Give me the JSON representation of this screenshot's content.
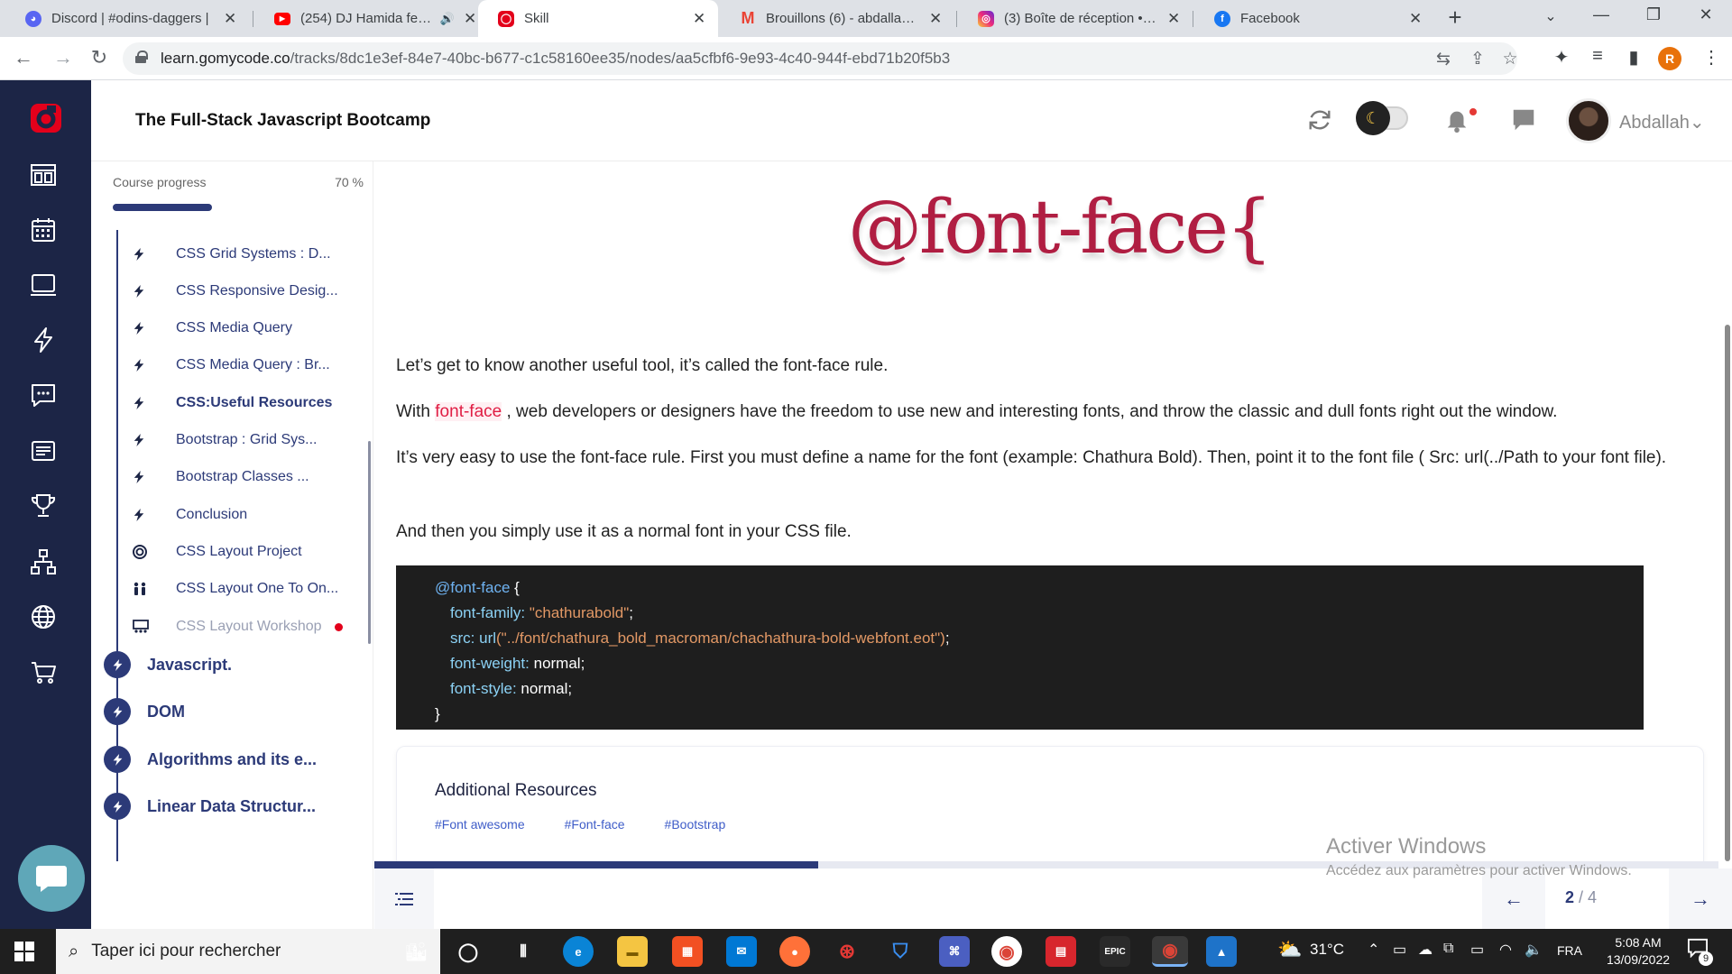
{
  "browser": {
    "tabs": [
      {
        "title": "Discord | #odins-daggers | ",
        "icon": "discord-icon",
        "color": "#5865f2"
      },
      {
        "title": "(254) DJ Hamida feat. A",
        "icon": "youtube-icon",
        "color": "#ff0000",
        "audio": "audio-playing-icon"
      },
      {
        "title": "Skill",
        "icon": "gomycode-icon",
        "color": "#e3001b",
        "active": true
      },
      {
        "title": "Brouillons (6) - abdallah.lah",
        "icon": "gmail-icon",
        "color": "#ea4335"
      },
      {
        "title": "(3) Boîte de réception • Dire",
        "icon": "instagram-icon",
        "color": "#d62976"
      },
      {
        "title": "Facebook",
        "icon": "facebook-icon",
        "color": "#1877f2"
      }
    ],
    "url_host": "learn.gomycode.co",
    "url_path": "/tracks/8dc1e3ef-84e7-40bc-b677-c1c58160ee35/nodes/aa5cfbf6-9e93-4c40-944f-ebd71b20f5b3",
    "profile_initial": "R"
  },
  "header": {
    "title": "The Full-Stack Javascript Bootcamp",
    "user_name": "Abdallah",
    "user_chevron": "⌄"
  },
  "sidebar": {
    "progress_label": "Course progress",
    "progress_text": "70 %",
    "progress_value": 0.7,
    "lessons": [
      {
        "label": "CSS Grid Systems : D...",
        "icon": "bolt-icon"
      },
      {
        "label": "CSS Responsive Desig...",
        "icon": "bolt-icon"
      },
      {
        "label": "CSS Media Query",
        "icon": "bolt-icon"
      },
      {
        "label": "CSS Media Query : Br...",
        "icon": "bolt-icon"
      },
      {
        "label": "CSS:Useful Resources",
        "icon": "bolt-icon",
        "active": true
      },
      {
        "label": "Bootstrap : Grid Sys...",
        "icon": "bolt-icon"
      },
      {
        "label": "Bootstrap Classes ...",
        "icon": "bolt-icon"
      },
      {
        "label": "Conclusion",
        "icon": "bolt-icon"
      },
      {
        "label": "CSS Layout Project",
        "icon": "target-icon"
      },
      {
        "label": "CSS Layout One To On...",
        "icon": "people-icon"
      },
      {
        "label": "CSS Layout Workshop",
        "icon": "workshop-icon",
        "dim": true,
        "dot": true
      }
    ],
    "modules": [
      {
        "label": "Javascript."
      },
      {
        "label": "DOM"
      },
      {
        "label": "Algorithms and its e..."
      },
      {
        "label": "Linear Data Structur..."
      }
    ]
  },
  "content": {
    "hero_text": "@font-face{",
    "p1": "Let’s get to know another useful tool, it’s called the font-face rule.",
    "p2_before": "With ",
    "p2_highlight": "font-face",
    "p2_after": " , web developers or designers have the freedom to use new and interesting fonts, and throw the classic and dull fonts right out the window.",
    "p3": "It’s very easy to use the font-face rule. First you must define a name for the font (example: Chathura Bold). Then, point it to the font file ( Src: url(../Path to your font file).",
    "p4": "And then you simply use it as a normal font in your CSS file.",
    "code": {
      "at_rule": "@font-face",
      "open": " {",
      "l1_prop": "font-family:",
      "l1_val": " \"chathurabold\"",
      "l1_end": ";",
      "l2_prop": "src:",
      "l2_fn": " url",
      "l2_val": "(\"../font/chathura_bold_macroman/chachathura-bold-webfont.eot\")",
      "l2_end": ";",
      "l3_prop": "font-weight:",
      "l3_val": " normal;",
      "l4_prop": "font-style:",
      "l4_val": " normal;",
      "close": "}"
    },
    "resources_title": "Additional Resources",
    "resource_tags": [
      "#Font awesome",
      "#Font-face",
      "#Bootstrap"
    ]
  },
  "pager": {
    "current": "2",
    "separator": " / ",
    "total": "4",
    "prev_glyph": "←",
    "next_glyph": "→",
    "lesson_progress": 0.33
  },
  "watermark": {
    "line1": "Activer Windows",
    "line2": "Accédez aux paramètres pour activer Windows."
  },
  "taskbar": {
    "search_placeholder": "Taper ici pour rechercher",
    "weather": "31°C",
    "language": "FRA",
    "time": "5:08 AM",
    "date": "13/09/2022",
    "notification_count": "9",
    "epic_label": "EPIC"
  }
}
